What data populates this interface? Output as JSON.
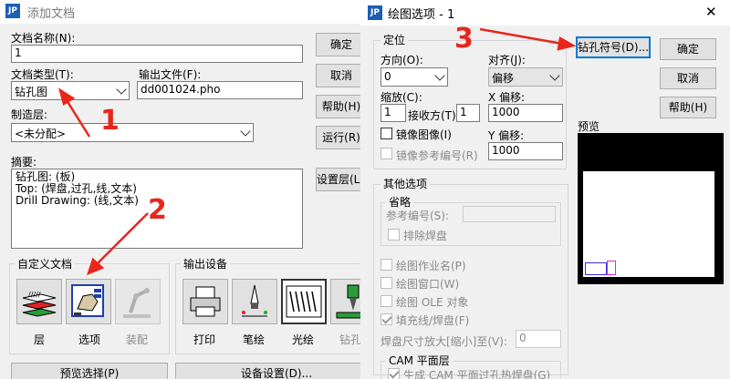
{
  "dialog1": {
    "title": "添加文档",
    "doc_name_label": "文档名称(N):",
    "doc_name_value": "1",
    "doc_type_label": "文档类型(T):",
    "doc_type_value": "钻孔图",
    "output_file_label": "输出文件(F):",
    "output_file_value": "dd001024.pho",
    "layer_label": "制造层:",
    "layer_value": "<未分配>",
    "summary_label": "摘要:",
    "summary_lines": [
      "钻孔图: (板)",
      "Top: (焊盘,过孔,线,文本)",
      "Drill Drawing: (线,文本)"
    ],
    "buttons": {
      "ok": "确定",
      "cancel": "取消",
      "help": "帮助(H)",
      "run": "运行(R)",
      "layers": "设置层(L)..."
    },
    "custom_group": "自定义文档",
    "custom_items": [
      "层",
      "选项",
      "装配"
    ],
    "output_group": "输出设备",
    "output_items": [
      "打印",
      "笔绘",
      "光绘",
      "钻孔"
    ],
    "bottom_buttons": [
      "预览选择(P)",
      "设备设置(D)..."
    ]
  },
  "dialog2": {
    "title": "绘图选项 - 1",
    "close_glyph": "✕",
    "position_group": "定位",
    "orientation_label": "方向(O):",
    "orientation_value": "0",
    "align_label": "对齐(J):",
    "align_value": "偏移",
    "scale_label": "缩放(C):",
    "scale_a": "1",
    "scale_mid": "接收方(T)",
    "scale_b": "1",
    "x_offset_label": "X 偏移:",
    "x_offset_value": "1000",
    "y_offset_label": "Y 偏移:",
    "y_offset_value": "1000",
    "mirror_label": "镜像图像(I)",
    "mirror_ref_label": "镜像参考编号(R)",
    "other_group": "其他选项",
    "omit_label": "省略",
    "ref_label": "参考编号(S):",
    "exclude_pads_label": "排除焊盘",
    "options": [
      "绘图作业名(P)",
      "绘图窗口(W)",
      "绘图 OLE 对象",
      "填充线/焊盘(F)"
    ],
    "pad_scale_label": "焊盘尺寸放大[缩小]至(V):",
    "pad_scale_value": "0",
    "cam_group": "CAM 平面层",
    "cam_option": "生成 CAM 平面过孔热焊盘(G)",
    "buttons": {
      "drill_symbol": "钻孔符号(D)...",
      "ok": "确定",
      "cancel": "取消",
      "help": "帮助(H)"
    },
    "preview_label": "预览"
  },
  "annotations": {
    "arrow1": "1",
    "arrow2": "2",
    "arrow3": "3"
  },
  "colors": {
    "annotation": "#e8261c",
    "accent": "#0078d7",
    "preview_bg": "#000000",
    "preview_blue": "#3b2bd6",
    "preview_magenta": "#e020e0"
  }
}
